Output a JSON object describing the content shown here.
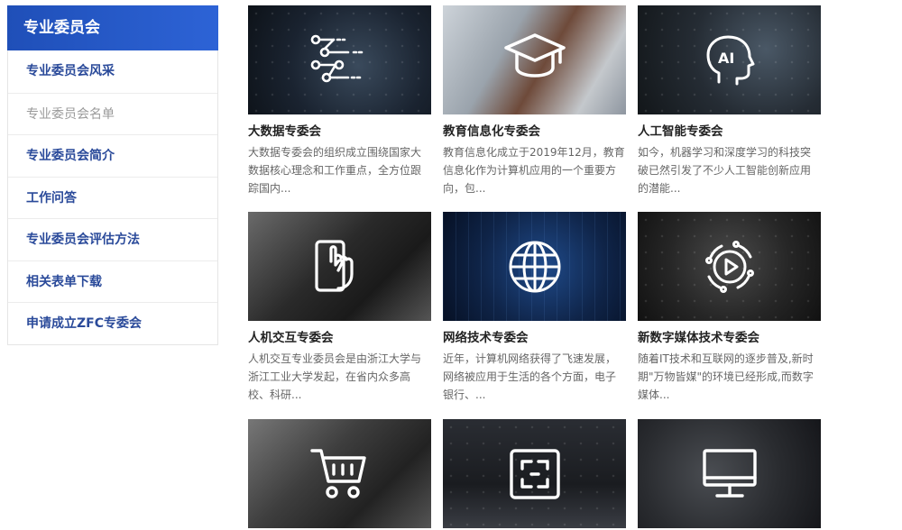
{
  "sidebar": {
    "title": "专业委员会",
    "items": [
      {
        "label": "专业委员会风采"
      },
      {
        "label": "专业委员会名单"
      },
      {
        "label": "专业委员会简介"
      },
      {
        "label": "工作问答"
      },
      {
        "label": "专业委员会评估方法"
      },
      {
        "label": "相关表单下载"
      },
      {
        "label": "申请成立ZFC专委会"
      }
    ],
    "active_index": 1,
    "accent_color": "#2d5cc8"
  },
  "cards": [
    {
      "title": "大数据专委会",
      "desc": "大数据专委会的组织成立围绕国家大数据核心理念和工作重点，全方位跟踪国内...",
      "icon": "circuit-icon"
    },
    {
      "title": "教育信息化专委会",
      "desc": "教育信息化成立于2019年12月，教育信息化作为计算机应用的一个重要方向，包...",
      "icon": "graduation-cap-icon"
    },
    {
      "title": "人工智能专委会",
      "desc": "如今，机器学习和深度学习的科技突破已然引发了不少人工智能创新应用的潜能...",
      "icon": "ai-head-icon"
    },
    {
      "title": "人机交互专委会",
      "desc": "人机交互专业委员会是由浙江大学与浙江工业大学发起，在省内众多高校、科研...",
      "icon": "touch-phone-icon"
    },
    {
      "title": "网络技术专委会",
      "desc": "近年，计算机网络获得了飞速发展，网络被应用于生活的各个方面，电子银行、...",
      "icon": "globe-icon"
    },
    {
      "title": "新数字媒体技术专委会",
      "desc": "随着IT技术和互联网的逐步普及,新时期\"万物皆媒\"的环境已经形成,而数字媒体...",
      "icon": "play-circle-icon"
    },
    {
      "title": "",
      "desc": "",
      "icon": "shopping-cart-icon"
    },
    {
      "title": "",
      "desc": "",
      "icon": "scan-frame-icon"
    },
    {
      "title": "",
      "desc": "",
      "icon": "monitor-icon"
    }
  ]
}
